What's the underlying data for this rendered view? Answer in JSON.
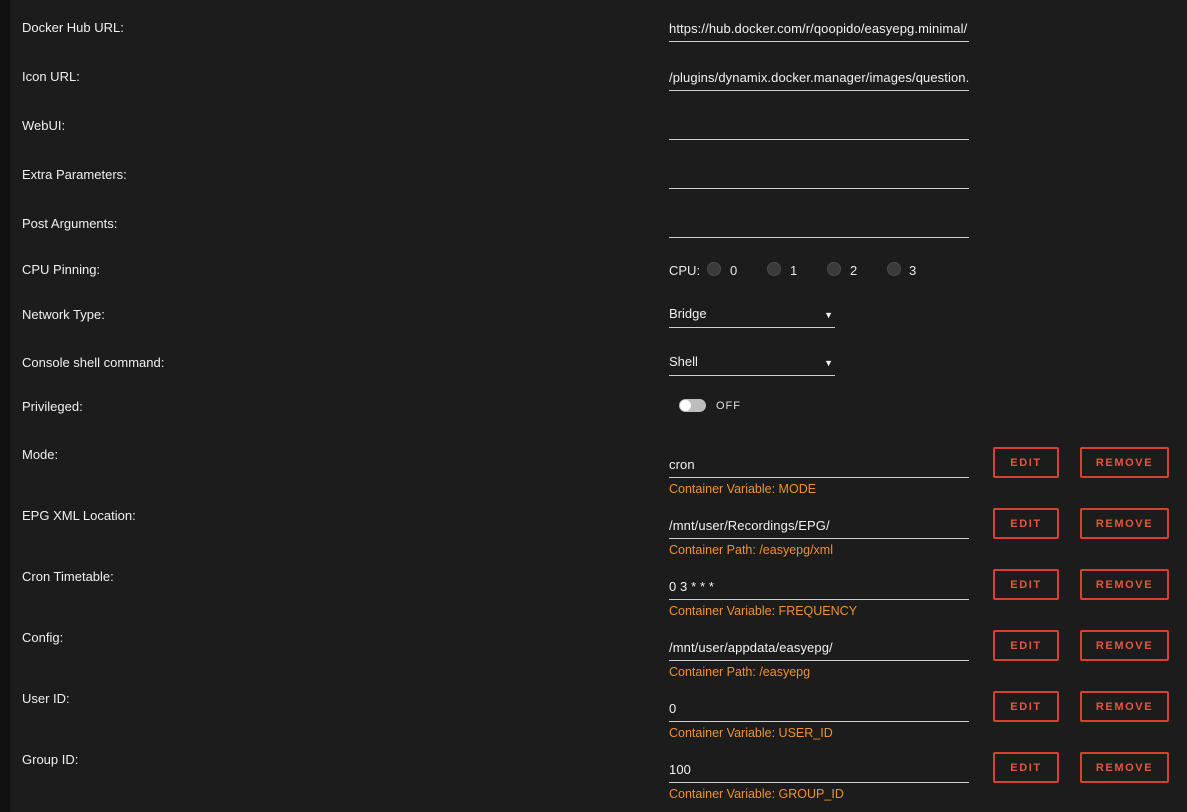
{
  "settings": {
    "docker_hub_url": {
      "label": "Docker Hub URL:",
      "value": "https://hub.docker.com/r/qoopido/easyepg.minimal/"
    },
    "icon_url": {
      "label": "Icon URL:",
      "value": "/plugins/dynamix.docker.manager/images/question.png"
    },
    "webui": {
      "label": "WebUI:",
      "value": ""
    },
    "extra_parameters": {
      "label": "Extra Parameters:",
      "value": ""
    },
    "post_arguments": {
      "label": "Post Arguments:",
      "value": ""
    },
    "cpu_pinning": {
      "label": "CPU Pinning:",
      "cpu_label": "CPU:",
      "cpus": [
        "0",
        "1",
        "2",
        "3"
      ]
    },
    "network_type": {
      "label": "Network Type:",
      "value": "Bridge"
    },
    "console_shell": {
      "label": "Console shell command:",
      "value": "Shell"
    },
    "privileged": {
      "label": "Privileged:",
      "state": "OFF"
    }
  },
  "buttons": {
    "edit": "EDIT",
    "remove": "REMOVE"
  },
  "config_items": [
    {
      "label": "Mode:",
      "value": "cron",
      "sub": "Container Variable: MODE"
    },
    {
      "label": "EPG XML Location:",
      "value": "/mnt/user/Recordings/EPG/",
      "sub": "Container Path: /easyepg/xml"
    },
    {
      "label": "Cron Timetable:",
      "value": "0 3 * * *",
      "sub": "Container Variable: FREQUENCY"
    },
    {
      "label": "Config:",
      "value": "/mnt/user/appdata/easyepg/",
      "sub": "Container Path: /easyepg"
    },
    {
      "label": "User ID:",
      "value": "0",
      "sub": "Container Variable: USER_ID"
    },
    {
      "label": "Group ID:",
      "value": "100",
      "sub": "Container Variable: GROUP_ID"
    }
  ]
}
